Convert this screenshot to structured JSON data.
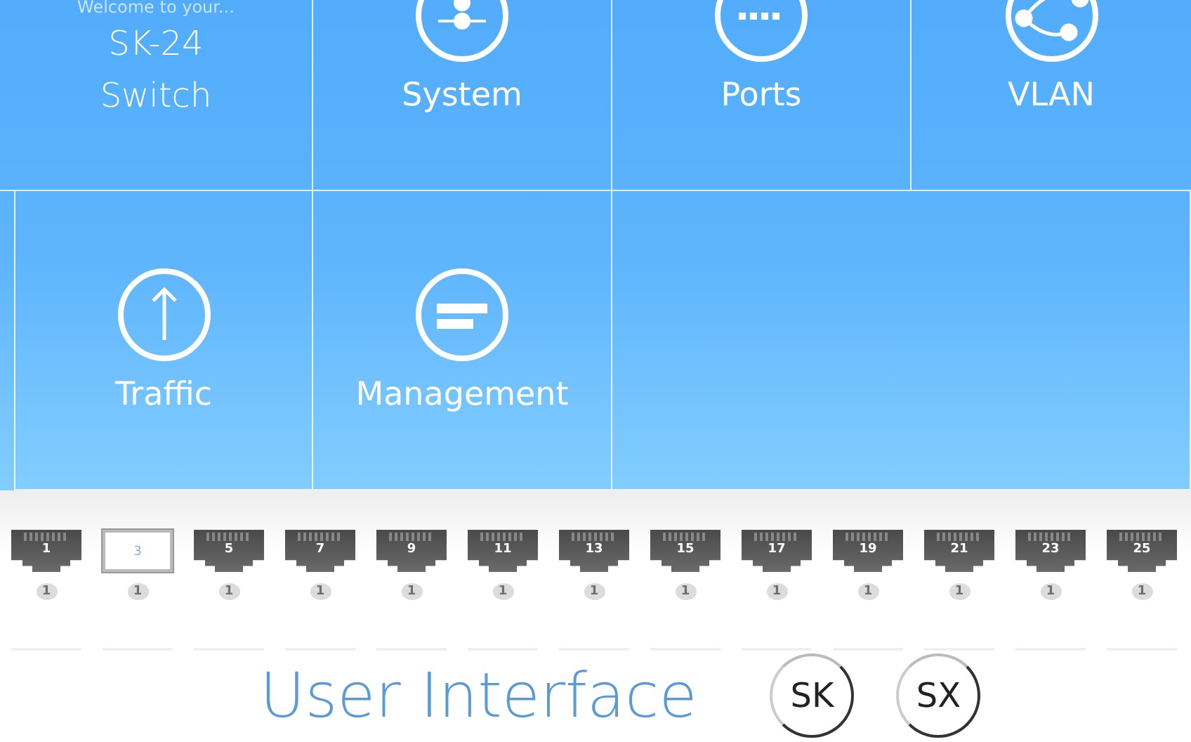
{
  "welcome": {
    "caption": "Welcome to your...",
    "model": "SK-24",
    "type": "Switch"
  },
  "tiles": [
    {
      "label": "System",
      "kind": "system"
    },
    {
      "label": "Ports",
      "kind": "ports"
    },
    {
      "label": "VLAN",
      "kind": "vlan"
    },
    {
      "label": "Traffic",
      "kind": "traffic"
    },
    {
      "label": "Management",
      "kind": "management"
    }
  ],
  "ports": [
    {
      "number": "1",
      "badge": "1",
      "selected": false
    },
    {
      "number": "3",
      "badge": "1",
      "selected": true
    },
    {
      "number": "5",
      "badge": "1",
      "selected": false
    },
    {
      "number": "7",
      "badge": "1",
      "selected": false
    },
    {
      "number": "9",
      "badge": "1",
      "selected": false
    },
    {
      "number": "11",
      "badge": "1",
      "selected": false
    },
    {
      "number": "13",
      "badge": "1",
      "selected": false
    },
    {
      "number": "15",
      "badge": "1",
      "selected": false
    },
    {
      "number": "17",
      "badge": "1",
      "selected": false
    },
    {
      "number": "19",
      "badge": "1",
      "selected": false
    },
    {
      "number": "21",
      "badge": "1",
      "selected": false
    },
    {
      "number": "23",
      "badge": "1",
      "selected": false
    },
    {
      "number": "25",
      "badge": "1",
      "selected": false
    }
  ],
  "footer": {
    "title": "User Interface",
    "buttons": [
      "SK",
      "SX"
    ]
  }
}
